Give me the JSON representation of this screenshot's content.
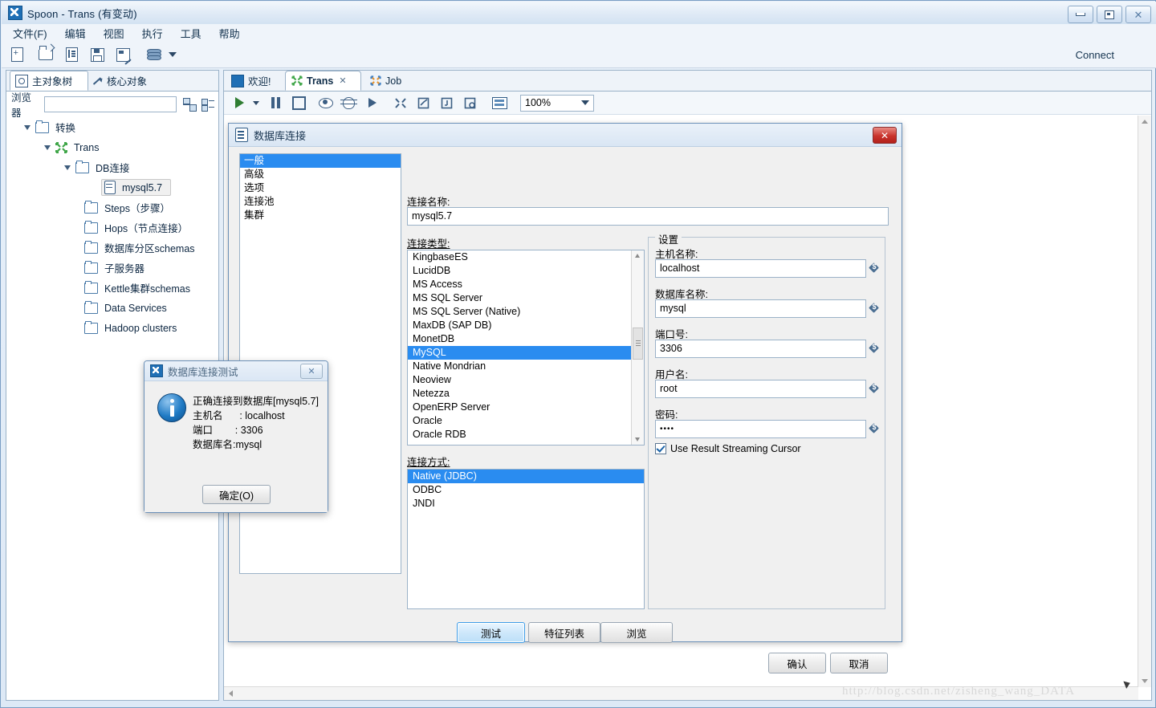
{
  "window": {
    "title": "Spoon - Trans (有变动)",
    "icon": "spoon-icon",
    "minimize": "–",
    "maximize": "□",
    "close": "✕"
  },
  "menu": {
    "items": [
      "文件(F)",
      "编辑",
      "视图",
      "执行",
      "工具",
      "帮助"
    ]
  },
  "toolbar": {
    "icons": [
      "new-file-icon",
      "open-file-icon",
      "explore-repository-icon",
      "save-icon",
      "save-as-icon",
      "layers-icon",
      "dropdown-caret-icon"
    ],
    "connect_label": "Connect"
  },
  "left_panel": {
    "tabs": [
      {
        "label": "主对象树",
        "icon": "tree-view-icon",
        "active": true
      },
      {
        "label": "核心对象",
        "icon": "pencil-icon",
        "active": false
      }
    ],
    "browser": {
      "label": "浏览器",
      "value": "",
      "placeholder": "",
      "buttons": [
        "hierarchy-view-icon",
        "flat-view-icon"
      ]
    },
    "tree": [
      {
        "label": "转换",
        "indent": 0,
        "icon": "folder-icon",
        "expanded": true,
        "selected": false
      },
      {
        "label": "Trans",
        "indent": 1,
        "icon": "transformation-icon",
        "expanded": true,
        "selected": false
      },
      {
        "label": "DB连接",
        "indent": 2,
        "icon": "folder-icon",
        "expanded": true,
        "selected": false
      },
      {
        "label": "mysql5.7",
        "indent": 3,
        "icon": "database-icon",
        "expanded": false,
        "selected": true
      },
      {
        "label": "Steps（步骤）",
        "indent": 2,
        "icon": "folder-icon",
        "expanded": false,
        "selected": false
      },
      {
        "label": "Hops（节点连接）",
        "indent": 2,
        "icon": "folder-icon",
        "expanded": false,
        "selected": false
      },
      {
        "label": "数据库分区schemas",
        "indent": 2,
        "icon": "folder-icon",
        "expanded": false,
        "selected": false
      },
      {
        "label": "子服务器",
        "indent": 2,
        "icon": "folder-icon",
        "expanded": false,
        "selected": false
      },
      {
        "label": "Kettle集群schemas",
        "indent": 2,
        "icon": "folder-icon",
        "expanded": false,
        "selected": false
      },
      {
        "label": "Data Services",
        "indent": 2,
        "icon": "folder-icon",
        "expanded": false,
        "selected": false
      },
      {
        "label": "Hadoop clusters",
        "indent": 2,
        "icon": "folder-icon",
        "expanded": false,
        "selected": false
      }
    ]
  },
  "editor": {
    "tabs": [
      {
        "label": "欢迎!",
        "icon": "welcome-icon",
        "active": false,
        "closable": false
      },
      {
        "label": "Trans",
        "icon": "transformation-icon",
        "active": true,
        "closable": true
      },
      {
        "label": "Job",
        "icon": "job-icon",
        "active": false,
        "closable": false
      }
    ],
    "toolbar_icons": [
      "run-icon",
      "run-options-caret-icon",
      "pause-icon",
      "stop-icon",
      "preview-icon",
      "debug-icon",
      "replay-icon",
      "verify-icon",
      "impact-analysis-icon",
      "sql-icon",
      "inspect-icon",
      "grid-icon"
    ],
    "zoom": {
      "value": "100%",
      "caret": "▼"
    }
  },
  "db_dialog": {
    "title": "数据库连接",
    "icon": "database-icon",
    "close": "✕",
    "categories": [
      {
        "label": "一般",
        "selected": true
      },
      {
        "label": "高级",
        "selected": false
      },
      {
        "label": "选项",
        "selected": false
      },
      {
        "label": "连接池",
        "selected": false
      },
      {
        "label": "集群",
        "selected": false
      }
    ],
    "connection_name": {
      "label": "连接名称:",
      "value": "mysql5.7"
    },
    "connection_type": {
      "label": "连接类型:",
      "items": [
        {
          "label": "KingbaseES",
          "selected": false
        },
        {
          "label": "LucidDB",
          "selected": false
        },
        {
          "label": "MS Access",
          "selected": false
        },
        {
          "label": "MS SQL Server",
          "selected": false
        },
        {
          "label": "MS SQL Server (Native)",
          "selected": false
        },
        {
          "label": "MaxDB (SAP DB)",
          "selected": false
        },
        {
          "label": "MonetDB",
          "selected": false
        },
        {
          "label": "MySQL",
          "selected": true
        },
        {
          "label": "Native Mondrian",
          "selected": false
        },
        {
          "label": "Neoview",
          "selected": false
        },
        {
          "label": "Netezza",
          "selected": false
        },
        {
          "label": "OpenERP Server",
          "selected": false
        },
        {
          "label": "Oracle",
          "selected": false
        },
        {
          "label": "Oracle RDB",
          "selected": false
        }
      ]
    },
    "connection_method": {
      "label": "连接方式:",
      "items": [
        {
          "label": "Native (JDBC)",
          "selected": true
        },
        {
          "label": "ODBC",
          "selected": false
        },
        {
          "label": "JNDI",
          "selected": false
        }
      ]
    },
    "settings": {
      "group_title": "设置",
      "fields": [
        {
          "label": "主机名称:",
          "value": "localhost",
          "variable_icon": "variable-icon"
        },
        {
          "label": "数据库名称:",
          "value": "mysql",
          "variable_icon": "variable-icon"
        },
        {
          "label": "端口号:",
          "value": "3306",
          "variable_icon": "variable-icon"
        },
        {
          "label": "用户名:",
          "value": "root",
          "variable_icon": "variable-icon"
        },
        {
          "label": "密码:",
          "value": "••••",
          "variable_icon": "variable-icon"
        }
      ],
      "checkbox": {
        "label": "Use Result Streaming Cursor",
        "checked": true
      }
    },
    "buttons": {
      "test": "测试",
      "feature_list": "特征列表",
      "explore": "浏览",
      "ok": "确认",
      "cancel": "取消"
    }
  },
  "test_dialog": {
    "title": "数据库连接测试",
    "icon": "spoon-icon",
    "close": "✕",
    "info_icon": "info-icon",
    "message": "正确连接到数据库[mysql5.7]\n主机名      : localhost\n端口        : 3306\n数据库名:mysql",
    "ok_button": "确定(O)"
  },
  "watermark": "http://blog.csdn.net/zisheng_wang_DATA",
  "colors": {
    "accent_blue": "#2a8cf0",
    "title_bar": "#e8f0f9",
    "panel_bg": "#f0f0f0",
    "close_red": "#c9332c",
    "tree_green": "#3fa648"
  }
}
